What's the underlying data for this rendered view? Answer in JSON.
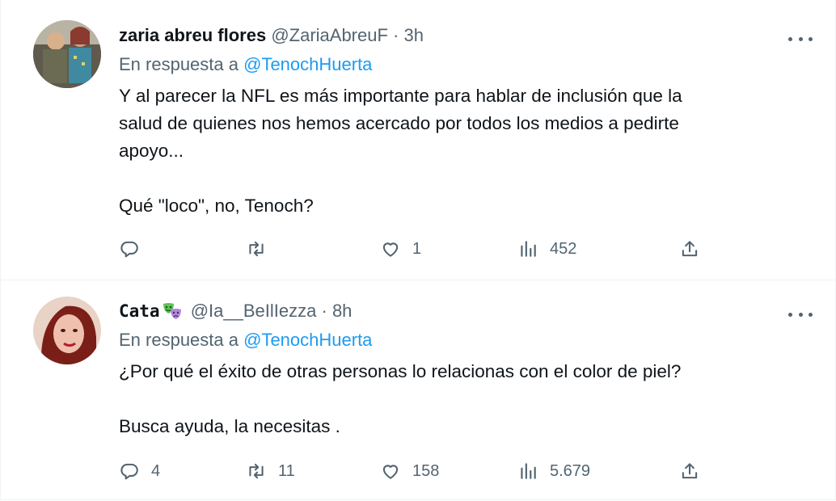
{
  "tweets": [
    {
      "name": "zaria abreu flores",
      "handle": "@ZariaAbreuF",
      "separator": "·",
      "time": "3h",
      "reply_prefix": "En respuesta a",
      "reply_to": "@TenochHuerta",
      "body": {
        "line1": "Y al parecer la NFL es más importante para hablar de inclusión que la",
        "line2": "salud de quienes nos hemos acercado por todos los medios a pedirte",
        "line3": "apoyo...",
        "line4": "Qué \"loco\", no, Tenoch?"
      },
      "actions": {
        "replies": "",
        "retweets": "",
        "likes": "1",
        "views": "452"
      }
    },
    {
      "name": "Cata",
      "name_emoji": "theater-masks-emoji",
      "handle": "@Ia__BeIlIezza",
      "separator": "·",
      "time": "8h",
      "reply_prefix": "En respuesta a",
      "reply_to": "@TenochHuerta",
      "body": {
        "line1": "¿Por qué el éxito de otras personas lo relacionas con el color de piel?",
        "line2": "Busca ayuda, la necesitas ."
      },
      "actions": {
        "replies": "4",
        "retweets": "11",
        "likes": "158",
        "views": "5.679"
      }
    }
  ],
  "icons": [
    "reply-icon",
    "retweet-icon",
    "like-icon",
    "views-icon",
    "share-icon",
    "more-icon"
  ],
  "colors": {
    "text": "#0f1419",
    "secondary": "#536471",
    "link": "#1d9bf0",
    "divider": "#eff3f4"
  }
}
